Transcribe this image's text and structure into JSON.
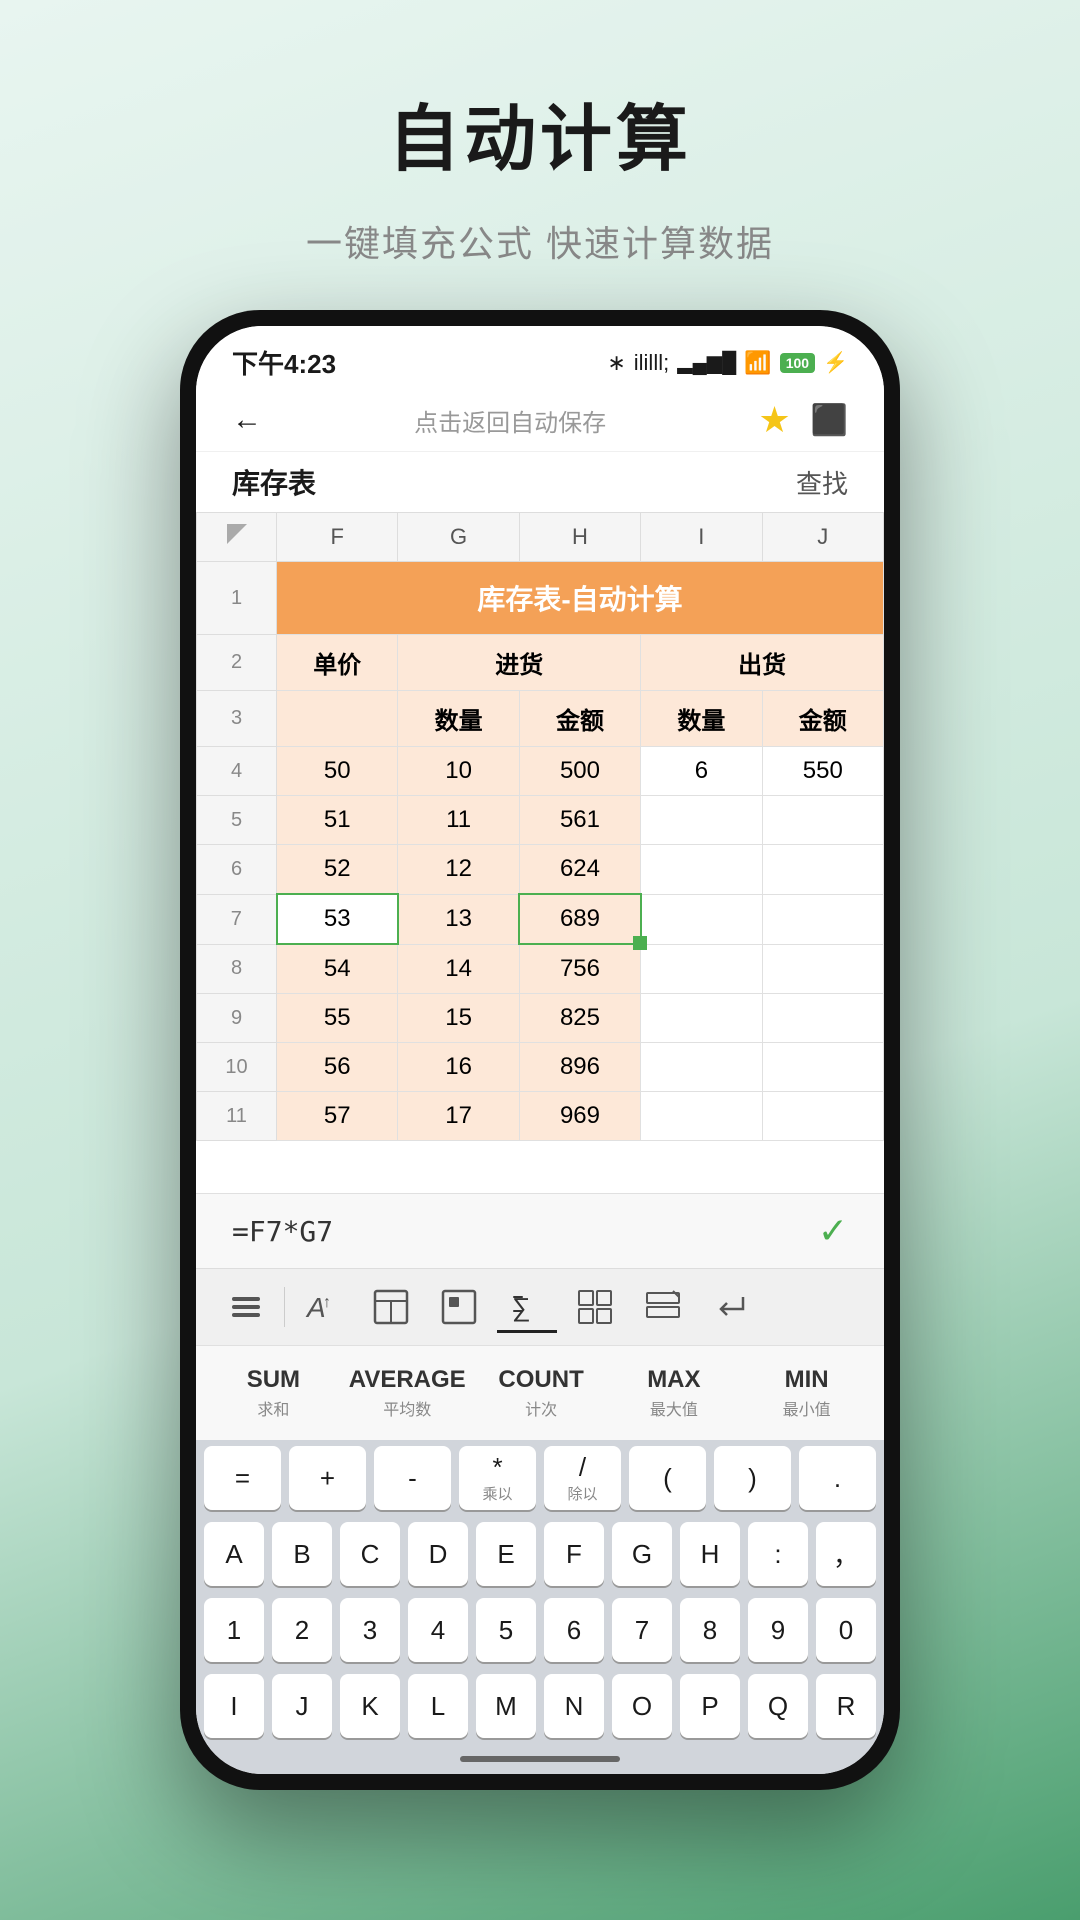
{
  "page": {
    "title": "自动计算",
    "subtitle": "一键填充公式 快速计算数据"
  },
  "status_bar": {
    "time": "下午4:23",
    "battery": "100"
  },
  "nav": {
    "title": "点击返回自动保存",
    "back_icon": "←",
    "star_icon": "★",
    "export_icon": "⬡"
  },
  "sheet": {
    "name": "库存表",
    "find": "查找"
  },
  "spreadsheet": {
    "merged_title": "库存表-自动计算",
    "columns": [
      "F",
      "G",
      "H",
      "I",
      "J"
    ],
    "row2": {
      "F": "单价",
      "G_H": "进货",
      "I_J": "出货"
    },
    "row3": {
      "G": "数量",
      "H": "金额",
      "I": "数量",
      "J": "金额"
    },
    "rows": [
      {
        "num": 4,
        "F": "50",
        "G": "10",
        "H": "500",
        "I": "6",
        "J": "550"
      },
      {
        "num": 5,
        "F": "51",
        "G": "11",
        "H": "561",
        "I": "",
        "J": ""
      },
      {
        "num": 6,
        "F": "52",
        "G": "12",
        "H": "624",
        "I": "",
        "J": ""
      },
      {
        "num": 7,
        "F": "53",
        "G": "13",
        "H": "689",
        "I": "",
        "J": "",
        "selected_F": true,
        "selected_H": true
      },
      {
        "num": 8,
        "F": "54",
        "G": "14",
        "H": "756",
        "I": "",
        "J": ""
      },
      {
        "num": 9,
        "F": "55",
        "G": "15",
        "H": "825",
        "I": "",
        "J": ""
      },
      {
        "num": 10,
        "F": "56",
        "G": "16",
        "H": "896",
        "I": "",
        "J": ""
      },
      {
        "num": 11,
        "F": "57",
        "G": "17",
        "H": "969",
        "I": "",
        "J": ""
      }
    ]
  },
  "formula_bar": {
    "formula": "=F7*G7",
    "confirm": "✓"
  },
  "keyboard_toolbar": {
    "tools": [
      {
        "icon": "⊟",
        "name": "collapse-icon"
      },
      {
        "icon": "A↑",
        "name": "text-format-icon",
        "active": false
      },
      {
        "icon": "⊞",
        "name": "table-icon"
      },
      {
        "icon": "⊡",
        "name": "cell-icon"
      },
      {
        "icon": "⊘",
        "name": "formula-icon",
        "active": true
      },
      {
        "icon": "⊞⊞",
        "name": "grid-icon"
      },
      {
        "icon": "⊟↑",
        "name": "row-icon"
      },
      {
        "icon": "↵",
        "name": "enter-icon"
      }
    ]
  },
  "functions": [
    {
      "name": "SUM",
      "desc": "求和"
    },
    {
      "name": "AVERAGE",
      "desc": "平均数"
    },
    {
      "name": "COUNT",
      "desc": "计次"
    },
    {
      "name": "MAX",
      "desc": "最大值"
    },
    {
      "name": "MIN",
      "desc": "最小值"
    }
  ],
  "keyboard": {
    "operator_row": [
      {
        "main": "=",
        "sub": ""
      },
      {
        "main": "+",
        "sub": ""
      },
      {
        "main": "-",
        "sub": ""
      },
      {
        "main": "*",
        "sub": "乘以"
      },
      {
        "main": "/",
        "sub": "除以"
      },
      {
        "main": "(",
        "sub": ""
      },
      {
        "main": ")",
        "sub": ""
      },
      {
        "main": ".",
        "sub": ""
      }
    ],
    "alpha_row1": [
      "A",
      "B",
      "C",
      "D",
      "E",
      "F",
      "G",
      "H",
      ":",
      "，"
    ],
    "alpha_row2": [
      "1",
      "2",
      "3",
      "4",
      "5",
      "6",
      "7",
      "8",
      "9",
      "0"
    ],
    "alpha_row3": [
      "I",
      "J",
      "K",
      "L",
      "M",
      "N",
      "O",
      "P",
      "Q",
      "R"
    ]
  }
}
